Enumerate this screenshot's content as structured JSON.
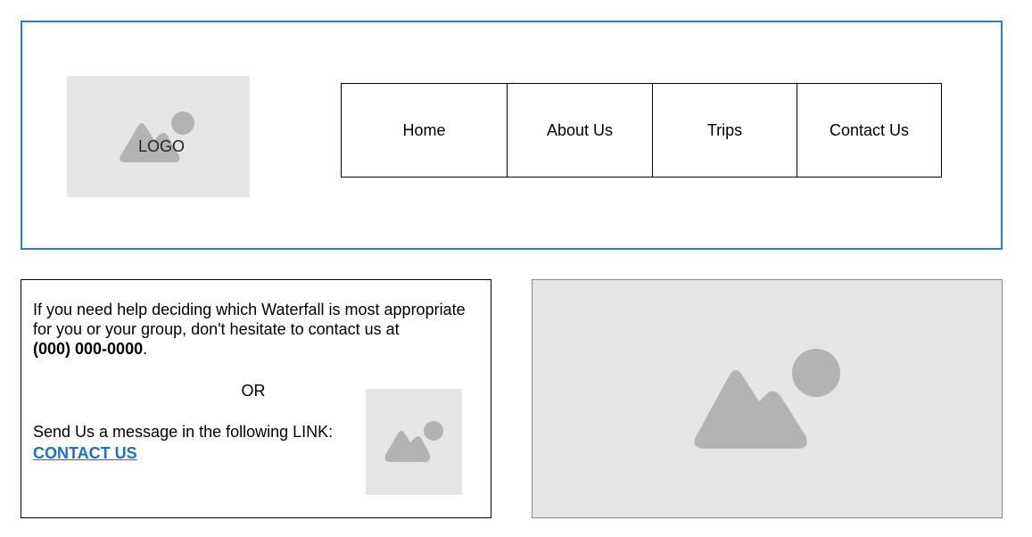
{
  "header": {
    "logo_label": "LOGO",
    "nav": [
      {
        "label": "Home"
      },
      {
        "label": "About Us"
      },
      {
        "label": "Trips"
      },
      {
        "label": "Contact Us"
      }
    ]
  },
  "contact": {
    "intro": "If you need help deciding which Waterfall is most appropriate for you or your group, don't hesitate to contact us at",
    "phone": "(000) 000-0000",
    "phone_suffix": ".",
    "or": "OR",
    "send_message": "Send Us a message in the following LINK:",
    "link_label": "CONTACT US"
  },
  "colors": {
    "header_border": "#2f7ad6",
    "placeholder_bg": "#e6e6e6",
    "placeholder_icon": "#b3b3b3",
    "link": "#1a6fd4"
  },
  "icons": {
    "logo_placeholder": "image-placeholder-icon",
    "small_placeholder": "image-placeholder-icon",
    "large_placeholder": "image-placeholder-icon"
  }
}
